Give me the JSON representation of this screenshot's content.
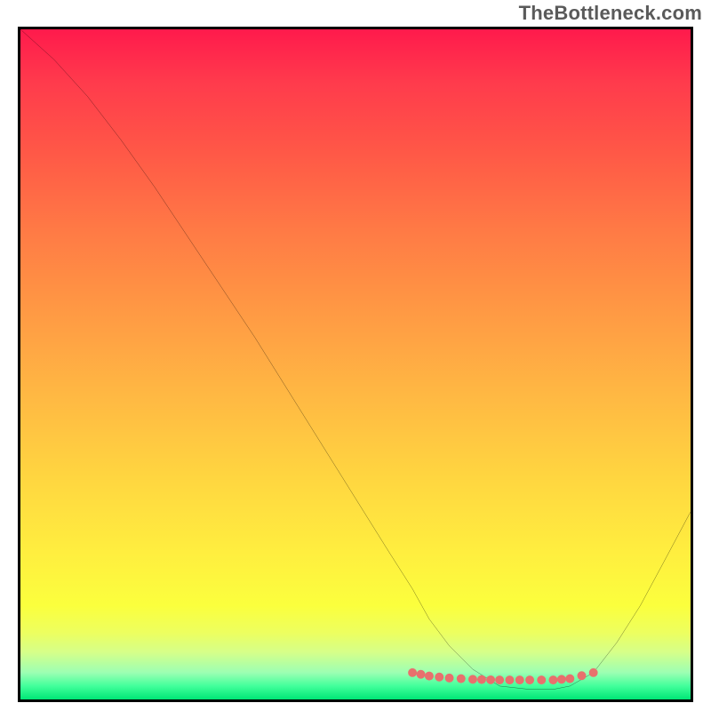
{
  "watermark": "TheBottleneck.com",
  "chart_data": {
    "type": "line",
    "title": "",
    "xlabel": "",
    "ylabel": "",
    "xlim": [
      0,
      100
    ],
    "ylim": [
      0,
      100
    ],
    "series": [
      {
        "name": "bottleneck-curve",
        "x": [
          0,
          5,
          10,
          15,
          20,
          25,
          30,
          35,
          40,
          45,
          50,
          55,
          58.5,
          61,
          64,
          67.5,
          71.5,
          76,
          79.5,
          82,
          85.5,
          89,
          92.5,
          96,
          100
        ],
        "y": [
          100,
          95.5,
          90,
          83.5,
          76.5,
          69,
          61.5,
          54,
          46,
          38,
          30,
          22,
          16.5,
          12,
          8,
          4.5,
          2,
          1.5,
          1.5,
          2,
          4,
          8.5,
          14,
          20.5,
          28
        ]
      },
      {
        "name": "valley-dotted",
        "x": [
          58.5,
          61,
          64,
          67.5,
          71.5,
          76,
          79.5,
          82,
          85.5
        ],
        "y": [
          4,
          3.5,
          3.2,
          3,
          2.9,
          2.9,
          2.9,
          3.1,
          4
        ]
      }
    ],
    "colors": {
      "curve": "#000000",
      "dots": "#e8706d"
    }
  }
}
